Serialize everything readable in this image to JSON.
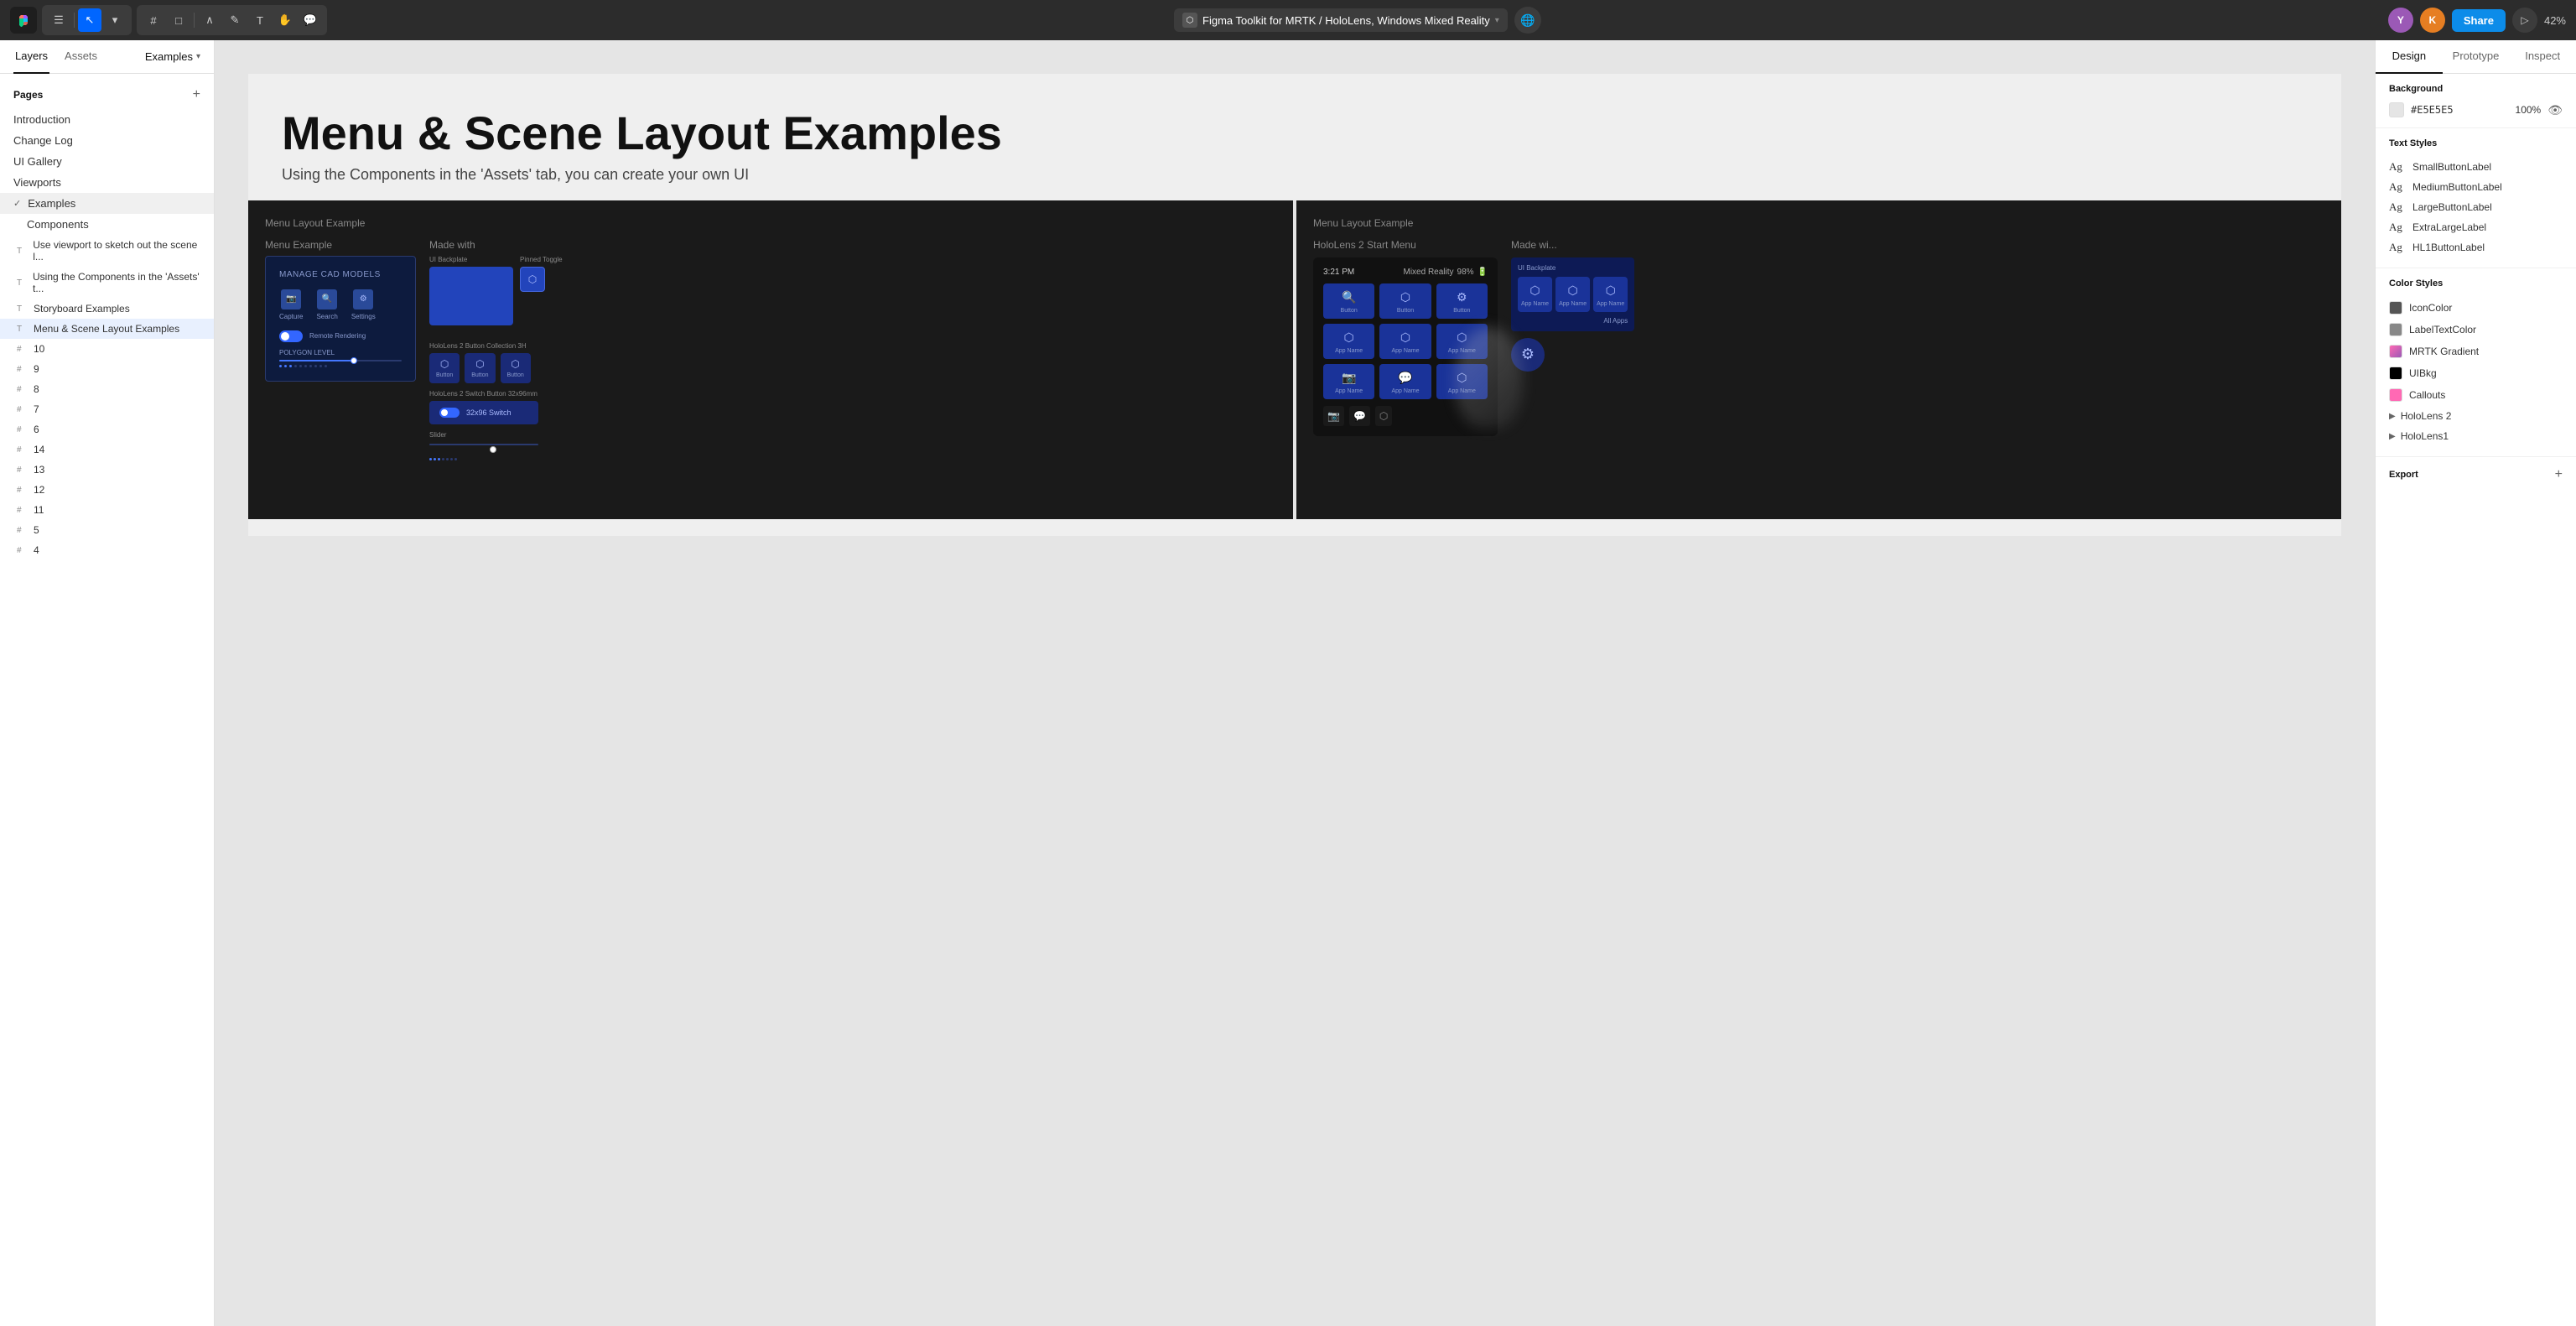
{
  "topbar": {
    "file_name": "Figma Toolkit for MRTK / HoloLens, Windows Mixed Reality",
    "zoom_level": "42%",
    "share_label": "Share",
    "avatars": [
      {
        "initials": "Y",
        "color": "#9b59b6"
      },
      {
        "initials": "K",
        "color": "#e67e22"
      }
    ]
  },
  "left_panel": {
    "tabs": [
      "Layers",
      "Assets"
    ],
    "examples_label": "Examples",
    "pages_title": "Pages",
    "pages": [
      {
        "label": "Introduction",
        "active": false
      },
      {
        "label": "Change Log",
        "active": false
      },
      {
        "label": "UI Gallery",
        "active": false
      },
      {
        "label": "Viewports",
        "active": false
      },
      {
        "label": "Examples",
        "active": true,
        "has_check": true
      },
      {
        "label": "Components",
        "active": false,
        "indent": true
      }
    ],
    "layers": [
      {
        "label": "Use viewport to sketch out the scene l...",
        "type": "text"
      },
      {
        "label": "Using the Components in the 'Assets' t...",
        "type": "text"
      },
      {
        "label": "Storyboard Examples",
        "type": "text"
      },
      {
        "label": "Menu & Scene Layout Examples",
        "type": "text"
      },
      {
        "label": "10",
        "type": "frame"
      },
      {
        "label": "9",
        "type": "frame"
      },
      {
        "label": "8",
        "type": "frame"
      },
      {
        "label": "7",
        "type": "frame"
      },
      {
        "label": "6",
        "type": "frame"
      },
      {
        "label": "14",
        "type": "frame"
      },
      {
        "label": "13",
        "type": "frame"
      },
      {
        "label": "12",
        "type": "frame"
      },
      {
        "label": "11",
        "type": "frame"
      },
      {
        "label": "5",
        "type": "frame"
      },
      {
        "label": "4",
        "type": "frame"
      }
    ]
  },
  "canvas": {
    "page_title": "Menu & Scene Layout Examples",
    "page_subtitle": "Using the Components in the 'Assets' tab, you can create your own UI",
    "example1_label": "Menu Layout Example",
    "example2_label": "Menu Layout Example",
    "menu_example_title": "Menu Example",
    "made_with_label": "Made with",
    "hololens_menu_title": "HoloLens 2 Start Menu",
    "menu_box_title": "MANAGE CAD MODELS",
    "menu_icons": [
      "Capture",
      "Search",
      "Settings"
    ],
    "toggle_label": "Remote Rendering",
    "polygon_label": "POLYGON LEVEL",
    "ui_backplate_label": "UI Backplate",
    "pinned_toggle_label": "Pinned Toggle",
    "button_collection_label": "HoloLens 2 Button Collection 3H",
    "switch_label": "HoloLens 2 Switch Button 32x96mm",
    "switch_text": "32x96 Switch",
    "slider_label": "Slider",
    "holo_time": "3:21 PM",
    "holo_mr": "Mixed Reality",
    "holo_battery": "98%",
    "holo_apps": [
      "App Name",
      "App Name",
      "App Name",
      "App Name",
      "App Name",
      "App Name",
      "App Name",
      "App Name",
      "App Name"
    ],
    "all_apps_label": "All Apps",
    "holo2_title": "Made wi..."
  },
  "right_panel": {
    "tabs": [
      "Design",
      "Prototype",
      "Inspect"
    ],
    "active_tab": "Design",
    "background_title": "Background",
    "bg_color": "#E5E5E5",
    "bg_opacity": "100%",
    "text_styles_title": "Text Styles",
    "text_styles": [
      {
        "label": "SmallButtonLabel"
      },
      {
        "label": "MediumButtonLabel"
      },
      {
        "label": "LargeButtonLabel"
      },
      {
        "label": "ExtraLargeLabel"
      },
      {
        "label": "HL1ButtonLabel"
      }
    ],
    "color_styles_title": "Color Styles",
    "color_styles": [
      {
        "name": "IconColor",
        "color": "#555555"
      },
      {
        "name": "LabelTextColor",
        "color": "#888888"
      },
      {
        "name": "MRTK Gradient",
        "color": "#ff69b4"
      },
      {
        "name": "UIBkg",
        "color": "#000000"
      },
      {
        "name": "Callouts",
        "color": "#ff69b4"
      }
    ],
    "color_groups": [
      {
        "name": "HoloLens 2"
      },
      {
        "name": "HoloLens1"
      }
    ],
    "export_title": "Export"
  }
}
